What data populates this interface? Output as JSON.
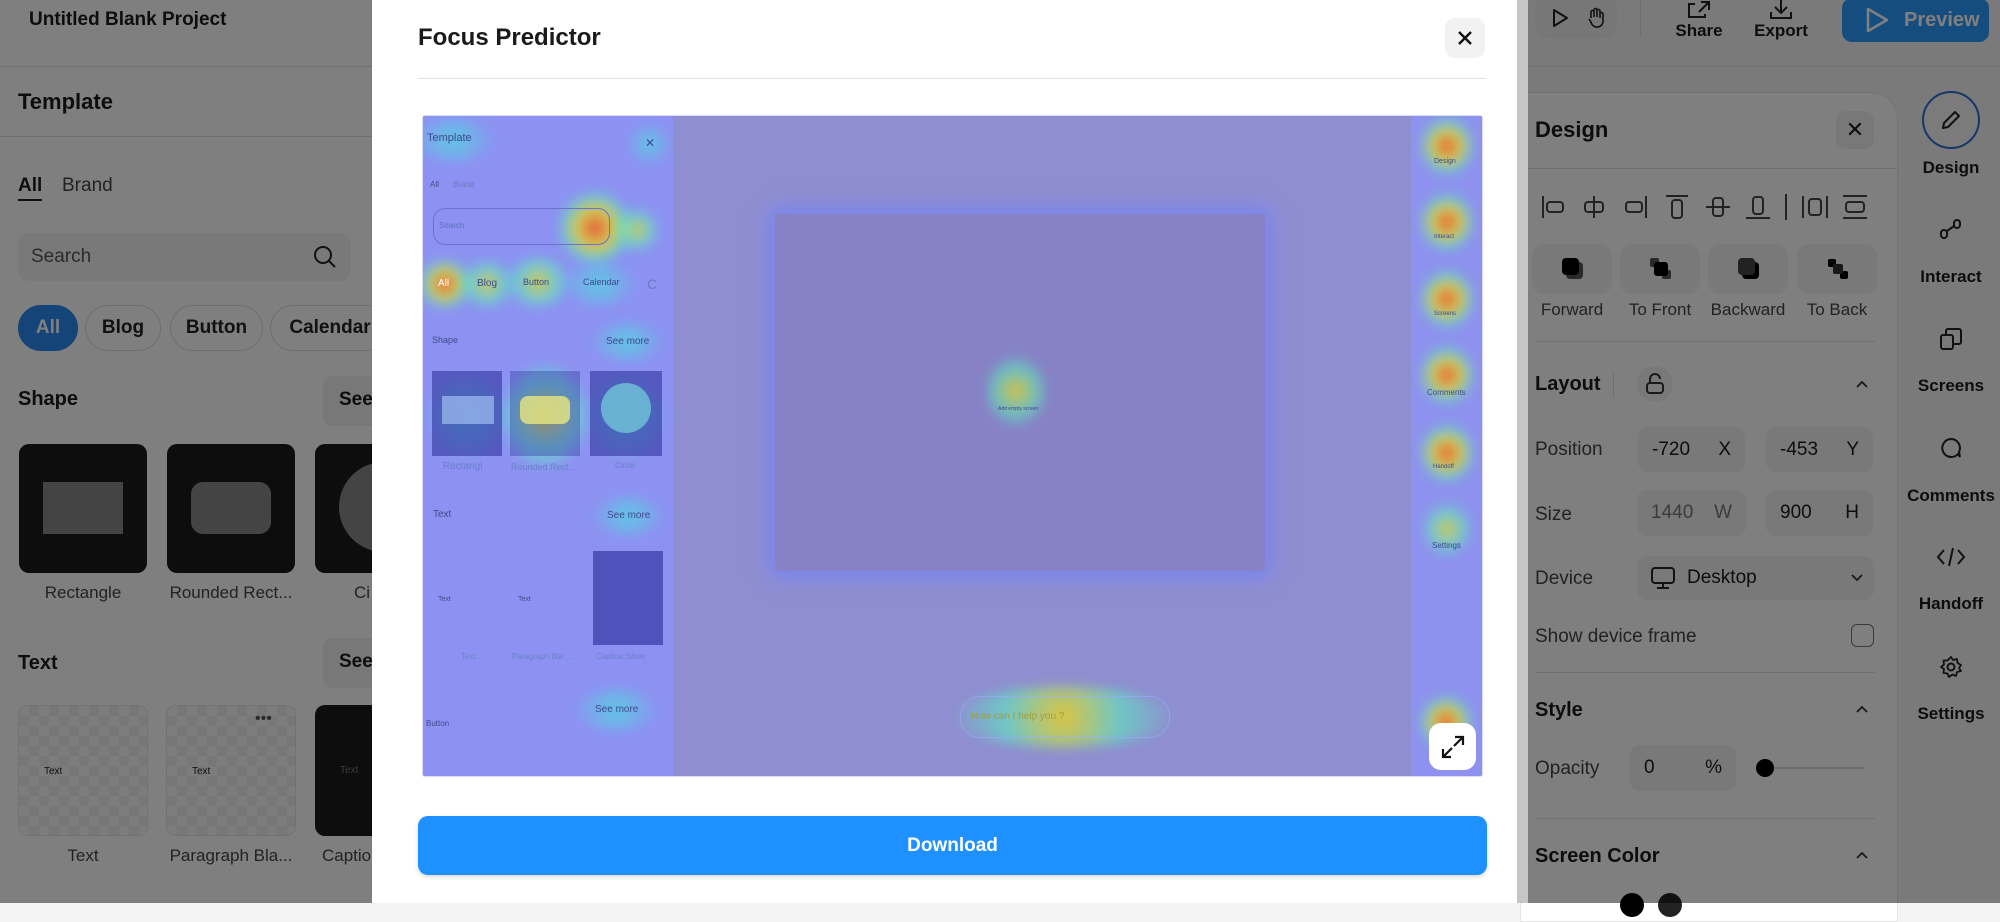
{
  "app": {
    "project_title": "Untitled Blank Project",
    "template_title": "Template",
    "tabs": [
      "All",
      "Brand"
    ],
    "search_placeholder": "Search",
    "chips": [
      "All",
      "Blog",
      "Button",
      "Calendar"
    ],
    "shape_section": "Shape",
    "text_section": "Text",
    "see_more": "See",
    "shape_tiles": [
      "Rectangle",
      "Rounded Rect...",
      "Ci"
    ],
    "text_tiles": [
      "Text",
      "Paragraph Bla...",
      "Captio"
    ],
    "tile_inner_text": "Text"
  },
  "toolbar": {
    "share": "Share",
    "export": "Export",
    "preview": "Preview"
  },
  "design_panel": {
    "title": "Design",
    "order_buttons": [
      "Forward",
      "To Front",
      "Backward",
      "To Back"
    ],
    "layout_title": "Layout",
    "position_label": "Position",
    "position_x": "-720",
    "position_x_unit": "X",
    "position_y": "-453",
    "position_y_unit": "Y",
    "size_label": "Size",
    "size_w": "1440",
    "size_w_unit": "W",
    "size_h": "900",
    "size_h_unit": "H",
    "device_label": "Device",
    "device_value": "Desktop",
    "show_frame_label": "Show device frame",
    "show_frame_checked": false,
    "style_title": "Style",
    "opacity_label": "Opacity",
    "opacity_value": "0",
    "opacity_unit": "%",
    "opacity_slider": 0,
    "screen_color_title": "Screen Color"
  },
  "rail": [
    "Design",
    "Interact",
    "Screens",
    "Comments",
    "Handoff",
    "Settings"
  ],
  "modal": {
    "title": "Focus Predictor",
    "download": "Download",
    "heatmap": {
      "template": "Template",
      "all": "All",
      "brand": "Brand",
      "search": "Search",
      "chips": [
        "All",
        "Blog",
        "Button",
        "Calendar",
        "C"
      ],
      "shape": "Shape",
      "see_more": "See more",
      "text": "Text",
      "button": "Button",
      "shape_tiles": [
        "Rectangl",
        "Rounded Rect ...",
        "Circle"
      ],
      "text_tiles": [
        "Text",
        "Paragraph Bla ...",
        "Caption Silver"
      ],
      "tile_text": "Text",
      "canvas_hint": "Add empty screen",
      "chat_placeholder": "How can I help you ?",
      "rail": [
        "Design",
        "Interact",
        "Screens",
        "Comments",
        "Handoff",
        "Settings"
      ]
    }
  },
  "colors": {
    "accent": "#1e90ff",
    "overlay": "rgba(0,0,0,0.5)"
  }
}
